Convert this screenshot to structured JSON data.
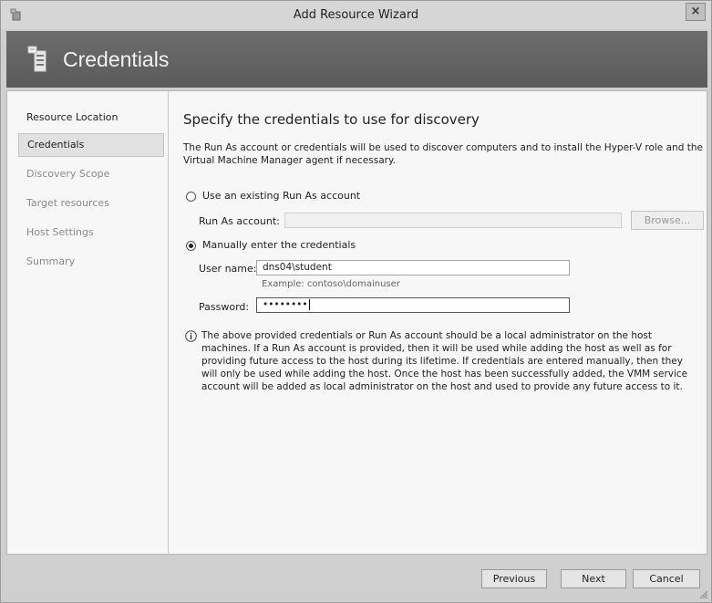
{
  "window": {
    "title": "Add Resource Wizard",
    "close_glyph": "×"
  },
  "banner": {
    "title": "Credentials",
    "icon": "wizard-server-icon"
  },
  "nav": {
    "items": [
      {
        "label": "Resource Location",
        "state": "done"
      },
      {
        "label": "Credentials",
        "state": "active"
      },
      {
        "label": "Discovery Scope",
        "state": "pending"
      },
      {
        "label": "Target resources",
        "state": "pending"
      },
      {
        "label": "Host Settings",
        "state": "pending"
      },
      {
        "label": "Summary",
        "state": "pending"
      }
    ]
  },
  "main": {
    "heading": "Specify the credentials to use for discovery",
    "description": "The Run As account or credentials will be used to discover computers and to install the Hyper-V role and the Virtual Machine Manager agent if necessary.",
    "option_existing": {
      "label": "Use an existing Run As account",
      "selected": false
    },
    "run_as": {
      "label": "Run As account:",
      "value": "",
      "browse_label": "Browse..."
    },
    "option_manual": {
      "label": "Manually enter the credentials",
      "selected": true
    },
    "username": {
      "label": "User name:",
      "value": "dns04\\student",
      "example": "Example: contoso\\domainuser"
    },
    "password": {
      "label": "Password:",
      "value": "••••••••"
    },
    "info": {
      "lines": [
        "The above provided credentials or Run As account should be a local administrator on the host",
        "machines. If a Run As account is provided, then it will be used while adding the host as well as for",
        "providing future access to the host during its lifetime. If credentials are entered manually, then they",
        "will only be used while adding the host. Once the host has been successfully added, the VMM service",
        "account will be added as local administrator on the host and used to provide any future access to it."
      ]
    }
  },
  "footer": {
    "previous_label": "Previous",
    "next_label": "Next",
    "cancel_label": "Cancel"
  },
  "colors": {
    "banner": "#5f5f5f",
    "content_bg": "#f7f7f7",
    "window_bg": "#cfcfcf"
  }
}
